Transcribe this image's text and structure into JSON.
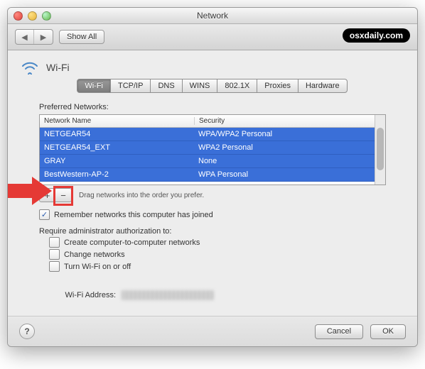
{
  "window": {
    "title": "Network"
  },
  "toolbar": {
    "show_all": "Show All"
  },
  "watermark": "osxdaily.com",
  "header": {
    "wifi_label": "Wi-Fi"
  },
  "tabs": [
    {
      "label": "Wi-Fi",
      "active": true
    },
    {
      "label": "TCP/IP",
      "active": false
    },
    {
      "label": "DNS",
      "active": false
    },
    {
      "label": "WINS",
      "active": false
    },
    {
      "label": "802.1X",
      "active": false
    },
    {
      "label": "Proxies",
      "active": false
    },
    {
      "label": "Hardware",
      "active": false
    }
  ],
  "preferred": {
    "label": "Preferred Networks:",
    "columns": {
      "name": "Network Name",
      "security": "Security"
    },
    "rows": [
      {
        "name": "NETGEAR54",
        "security": "WPA/WPA2 Personal"
      },
      {
        "name": "NETGEAR54_EXT",
        "security": "WPA2 Personal"
      },
      {
        "name": "GRAY",
        "security": "None"
      },
      {
        "name": "BestWestern-AP-2",
        "security": "WPA Personal"
      }
    ],
    "drag_hint": "Drag networks into the order you prefer.",
    "add_label": "+",
    "remove_label": "−"
  },
  "remember": {
    "checked": true,
    "label": "Remember networks this computer has joined"
  },
  "admin": {
    "label": "Require administrator authorization to:",
    "opts": [
      {
        "checked": false,
        "label": "Create computer-to-computer networks"
      },
      {
        "checked": false,
        "label": "Change networks"
      },
      {
        "checked": false,
        "label": "Turn Wi-Fi on or off"
      }
    ]
  },
  "wifi_address": {
    "label": "Wi-Fi Address:"
  },
  "buttons": {
    "help": "?",
    "cancel": "Cancel",
    "ok": "OK"
  }
}
